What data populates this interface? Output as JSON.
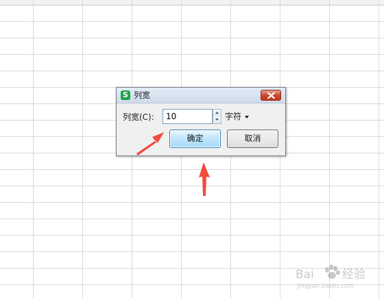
{
  "dialog": {
    "title": "列宽",
    "app_icon_glyph": "S",
    "width_label": "列宽(C):",
    "width_value": "10",
    "unit_label": "字符",
    "ok_label": "确定",
    "cancel_label": "取消"
  },
  "icons": {
    "app": "wps-spreadsheet-icon",
    "close": "close-icon",
    "spin_up": "spin-up-icon",
    "spin_down": "spin-down-icon",
    "unit_caret": "caret-down-icon"
  },
  "colors": {
    "accent_arrow": "#f24c3d",
    "app_icon": "#1ea34a",
    "close_button": "#c9462a",
    "ok_button_border": "#3c7fb1",
    "grid_line": "#d9d9d9"
  },
  "watermark": {
    "text_main": "Bai du 经验",
    "text_sub": "jingyan.baidu.com"
  }
}
